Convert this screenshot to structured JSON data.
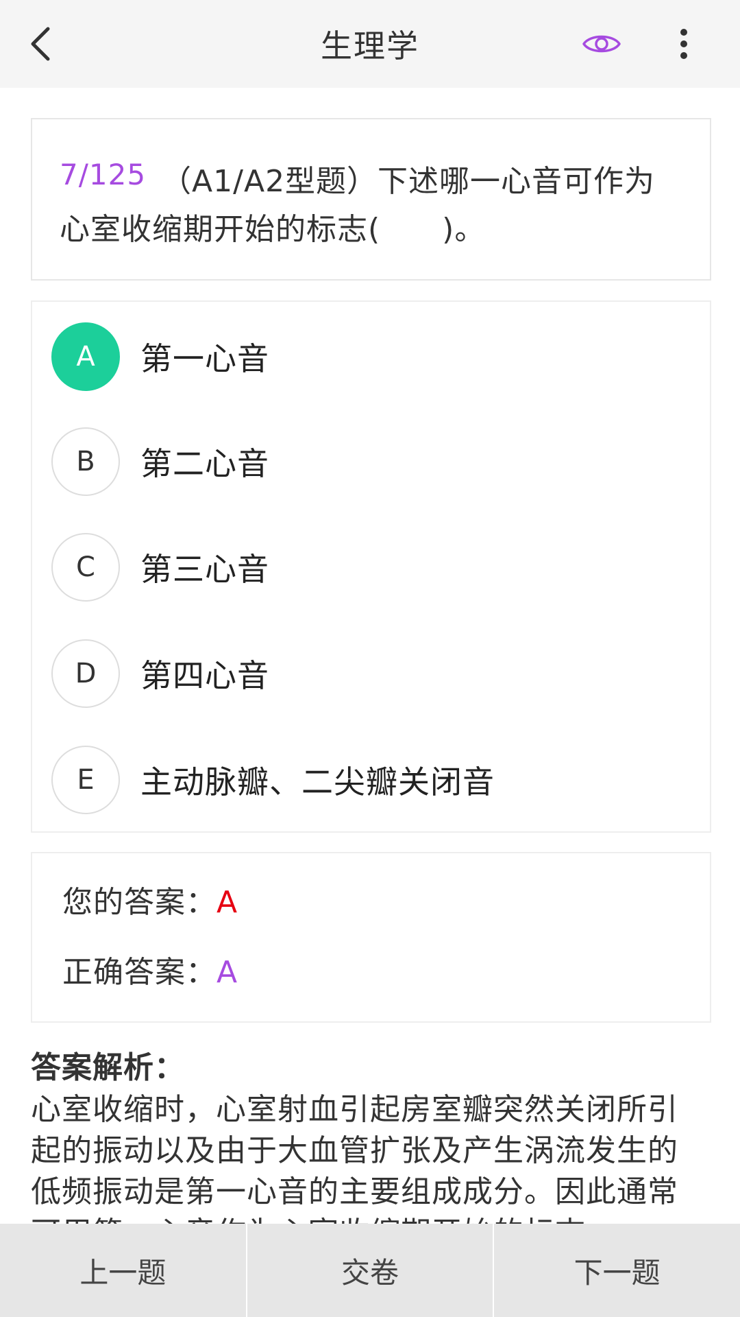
{
  "header": {
    "title": "生理学",
    "back_icon": "chevron-left-icon",
    "eye_icon": "eye-icon",
    "more_icon": "more-vertical-icon",
    "accent_color": "#a64be0"
  },
  "question": {
    "index": "7/125",
    "text": "（A1/A2型题）下述哪一心音可作为心室收缩期开始的标志(　　)。"
  },
  "options": [
    {
      "letter": "A",
      "text": "第一心音",
      "selected": true
    },
    {
      "letter": "B",
      "text": "第二心音",
      "selected": false
    },
    {
      "letter": "C",
      "text": "第三心音",
      "selected": false
    },
    {
      "letter": "D",
      "text": "第四心音",
      "selected": false
    },
    {
      "letter": "E",
      "text": "主动脉瓣、二尖瓣关闭音",
      "selected": false
    }
  ],
  "answer": {
    "your_label": "您的答案：",
    "your_value": "A",
    "correct_label": "正确答案：",
    "correct_value": "A"
  },
  "analysis": {
    "title": "答案解析：",
    "body": "心室收缩时，心室射血引起房室瓣突然关闭所引起的振动以及由于大血管扩张及产生涡流发生的低频振动是第一心音的主要组成成分。因此通常可用第一心音作为心室收缩期开始的标志。"
  },
  "bottom_bar": {
    "prev_label": "上一题",
    "submit_label": "交卷",
    "next_label": "下一题"
  },
  "colors": {
    "selected_option": "#1ccf9a",
    "your_answer": "#e60012",
    "correct_answer": "#a64be0"
  }
}
